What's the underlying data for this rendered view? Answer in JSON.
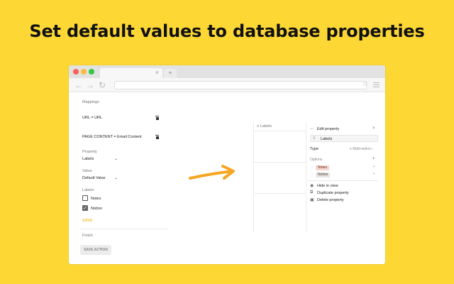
{
  "headline": "Set default values to database properties",
  "browser": {
    "tab_close": "×",
    "newtab": "+",
    "nav": {
      "back": "←",
      "forward": "→",
      "reload": "↻"
    },
    "star": "☆"
  },
  "form": {
    "mappings_label": "Mappings",
    "mapping_1": "URL = URL",
    "mapping_2": "PAGE CONTENT = Email Content",
    "property_label": "Property",
    "property_value": "Labels",
    "value_label": "Value",
    "value_value": "Default Value",
    "labels_label": "Labels",
    "option_notes": "Notes",
    "option_notion": "Notion",
    "notes_checked": false,
    "notion_checked": true,
    "save": "SAVE",
    "finish_label": "Finish",
    "save_action": "SAVE ACTION"
  },
  "database": {
    "column_header": "Labels",
    "panel_title": "Edit property",
    "property_name": "Labels",
    "type_label": "Type",
    "type_value": "Multi-select",
    "options_label": "Options",
    "options": [
      "Notes",
      "Notion"
    ],
    "actions": [
      "Hide in view",
      "Duplicate property",
      "Delete property"
    ]
  },
  "colors": {
    "background": "#fdd835",
    "arrow": "#f5a623",
    "save": "#f4c542"
  },
  "icons": {
    "trash": "trash-icon",
    "chevron": "chevron-down-icon",
    "arrow": "arrow-right-icon"
  }
}
